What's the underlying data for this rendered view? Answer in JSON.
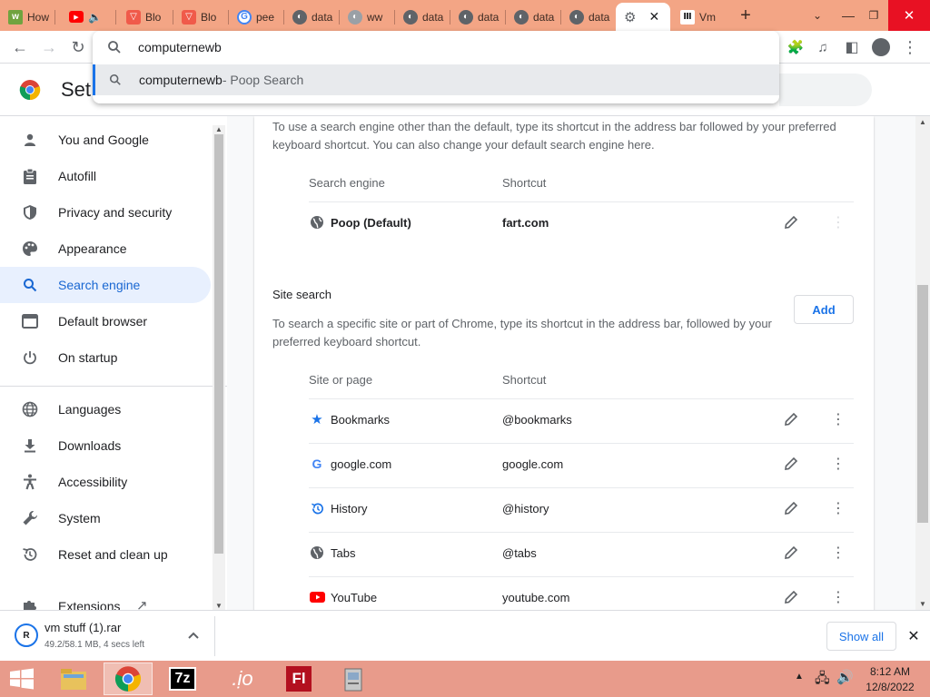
{
  "tabs": [
    {
      "title": "How",
      "icon": "wikihow-icon",
      "color": "#70a33f"
    },
    {
      "title": "",
      "icon": "youtube-icon",
      "color": "#ff0000",
      "audio": "🔈"
    },
    {
      "title": "Blo",
      "icon": "brave-icon",
      "color": "#f05a4a"
    },
    {
      "title": "Blo",
      "icon": "brave-icon",
      "color": "#f05a4a"
    },
    {
      "title": "pee",
      "icon": "google-icon",
      "color": "#4285f4"
    },
    {
      "title": "data",
      "icon": "globe-icon",
      "color": "#5f6368"
    },
    {
      "title": "ww",
      "icon": "globe-icon",
      "color": "#9aa0a6"
    },
    {
      "title": "data",
      "icon": "globe-icon",
      "color": "#5f6368"
    },
    {
      "title": "data",
      "icon": "globe-icon",
      "color": "#5f6368"
    },
    {
      "title": "data",
      "icon": "globe-icon",
      "color": "#5f6368"
    },
    {
      "title": "data",
      "icon": "globe-icon",
      "color": "#5f6368"
    }
  ],
  "active_tab": {
    "icon": "gear-icon",
    "close": "✕"
  },
  "last_tab": {
    "title": "Vm",
    "icon": "bank-icon"
  },
  "omnibox": {
    "value": "computernewb",
    "suggestion": "computernewb",
    "suggestion_desc": " - Poop Search"
  },
  "settings_title": "Set",
  "sidebar": {
    "items": [
      {
        "label": "You and Google",
        "icon": "person-icon",
        "glyph": "👤"
      },
      {
        "label": "Autofill",
        "icon": "clipboard-icon",
        "glyph": "📋"
      },
      {
        "label": "Privacy and security",
        "icon": "shield-icon",
        "glyph": "🛡"
      },
      {
        "label": "Appearance",
        "icon": "palette-icon",
        "glyph": "🎨"
      },
      {
        "label": "Search engine",
        "icon": "search-icon",
        "glyph": "🔍",
        "selected": true
      },
      {
        "label": "Default browser",
        "icon": "browser-icon",
        "glyph": "▭"
      },
      {
        "label": "On startup",
        "icon": "power-icon",
        "glyph": "⏻"
      },
      {
        "label": "Languages",
        "icon": "globe-icon",
        "glyph": "🌐"
      },
      {
        "label": "Downloads",
        "icon": "download-icon",
        "glyph": "⤓"
      },
      {
        "label": "Accessibility",
        "icon": "accessibility-icon",
        "glyph": "☥"
      },
      {
        "label": "System",
        "icon": "wrench-icon",
        "glyph": "🔧"
      },
      {
        "label": "Reset and clean up",
        "icon": "restore-icon",
        "glyph": "↺"
      },
      {
        "label": "Extensions",
        "icon": "puzzle-icon",
        "glyph": "🧩",
        "external": "↗"
      }
    ]
  },
  "search_engine": {
    "description": "To use a search engine other than the default, type its shortcut in the address bar followed by your preferred keyboard shortcut. You can also change your default search engine here.",
    "col_engine": "Search engine",
    "col_shortcut": "Shortcut",
    "default_row": {
      "name": "Poop (Default)",
      "shortcut": "fart.com",
      "icon": "globe-icon"
    }
  },
  "site_search": {
    "heading": "Site search",
    "add_label": "Add",
    "description": "To search a specific site or part of Chrome, type its shortcut in the address bar, followed by your preferred keyboard shortcut.",
    "col_site": "Site or page",
    "col_shortcut": "Shortcut",
    "rows": [
      {
        "name": "Bookmarks",
        "shortcut": "@bookmarks",
        "icon": "star-icon",
        "glyph": "★",
        "color": "#1a73e8"
      },
      {
        "name": "google.com",
        "shortcut": "google.com",
        "icon": "google-icon",
        "glyph": "G",
        "color": "#4285f4"
      },
      {
        "name": "History",
        "shortcut": "@history",
        "icon": "history-icon",
        "glyph": "↺",
        "color": "#1a73e8"
      },
      {
        "name": "Tabs",
        "shortcut": "@tabs",
        "icon": "globe-icon",
        "glyph": "●",
        "color": "#5f6368"
      },
      {
        "name": "YouTube",
        "shortcut": "youtube.com",
        "icon": "youtube-icon",
        "glyph": "▶",
        "color": "#ff0000"
      }
    ]
  },
  "download": {
    "filename": "vm stuff (1).rar",
    "status": "49.2/58.1 MB, 4 secs left",
    "show_all": "Show all"
  },
  "taskbar": {
    "time": "8:12 AM",
    "date": "12/8/2022",
    "apps": [
      "explorer-icon",
      "chrome-icon",
      "7zip-icon",
      "java-icon",
      "flash-icon",
      "installer-icon"
    ]
  },
  "colors": {
    "accent": "#1a73e8",
    "tabstrip": "#f3a585",
    "taskbar": "#e89b8b"
  }
}
